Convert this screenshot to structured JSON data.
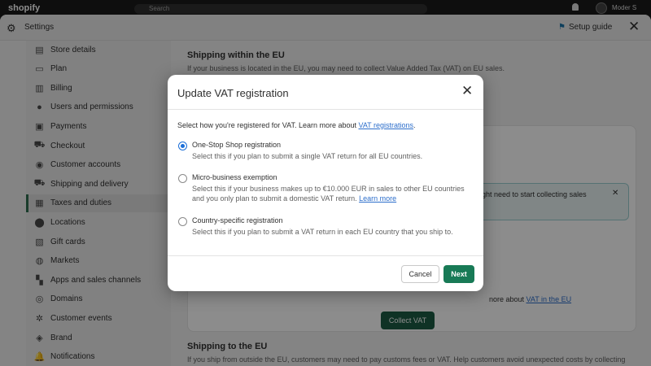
{
  "topbar": {
    "logo": "shopify",
    "search_placeholder": "Search",
    "user": "Moder S"
  },
  "window": {
    "title": "Settings",
    "setup_guide": "Setup guide",
    "flag_icon": "flag-icon"
  },
  "sidebar": {
    "items": [
      {
        "label": "Store details",
        "icon": "store-icon"
      },
      {
        "label": "Plan",
        "icon": "plan-icon"
      },
      {
        "label": "Billing",
        "icon": "billing-icon"
      },
      {
        "label": "Users and permissions",
        "icon": "user-icon"
      },
      {
        "label": "Payments",
        "icon": "payments-icon"
      },
      {
        "label": "Checkout",
        "icon": "cart-icon"
      },
      {
        "label": "Customer accounts",
        "icon": "person-icon"
      },
      {
        "label": "Shipping and delivery",
        "icon": "truck-icon"
      },
      {
        "label": "Taxes and duties",
        "icon": "tax-icon",
        "active": true
      },
      {
        "label": "Locations",
        "icon": "location-icon"
      },
      {
        "label": "Gift cards",
        "icon": "gift-icon"
      },
      {
        "label": "Markets",
        "icon": "globe-icon"
      },
      {
        "label": "Apps and sales channels",
        "icon": "apps-icon"
      },
      {
        "label": "Domains",
        "icon": "domain-icon"
      },
      {
        "label": "Customer events",
        "icon": "events-icon"
      },
      {
        "label": "Brand",
        "icon": "brand-icon"
      },
      {
        "label": "Notifications",
        "icon": "bell-icon"
      }
    ]
  },
  "main": {
    "section1_title": "Shipping within the EU",
    "section1_desc": "If your business is located in the EU, you may need to collect Value Added Tax (VAT) on EU sales.",
    "banner_text": "ght need to start collecting sales",
    "more_prefix": "nore about ",
    "more_link": "VAT in the EU",
    "collect_button": "Collect VAT",
    "section2_title": "Shipping to the EU",
    "section2_desc": "If you ship from outside the EU, customers may need to pay customs fees or VAT. Help customers avoid unexpected costs by collecting"
  },
  "modal": {
    "title": "Update VAT registration",
    "intro_prefix": "Select how you're registered for VAT. Learn more about ",
    "intro_link": "VAT registrations",
    "intro_suffix": ".",
    "options": [
      {
        "label": "One-Stop Shop registration",
        "desc": "Select this if you plan to submit a single VAT return for all EU countries.",
        "checked": true
      },
      {
        "label": "Micro-business exemption",
        "desc": "Select this if your business makes up to €10.000 EUR in sales to other EU countries and you only plan to submit a domestic VAT return.",
        "link": "Learn more",
        "checked": false
      },
      {
        "label": "Country-specific registration",
        "desc": "Select this if you plan to submit a VAT return in each EU country that you ship to.",
        "checked": false
      }
    ],
    "cancel": "Cancel",
    "next": "Next"
  }
}
